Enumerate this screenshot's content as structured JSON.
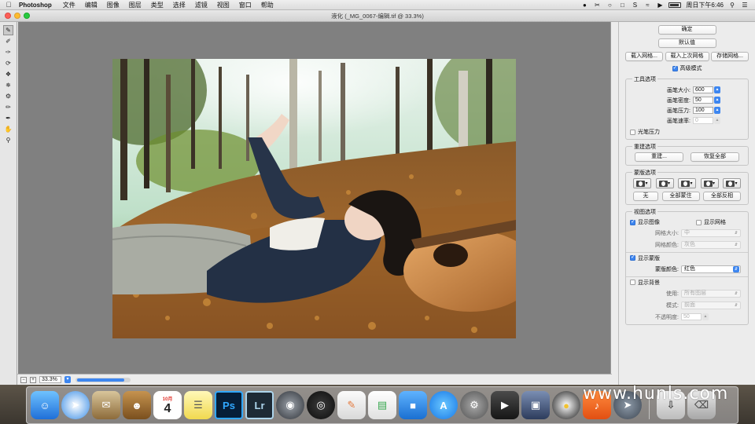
{
  "menubar": {
    "app_name": "Photoshop",
    "menus": [
      "文件",
      "编辑",
      "图像",
      "图层",
      "类型",
      "选择",
      "滤镜",
      "视图",
      "窗口",
      "帮助"
    ],
    "clock": "周日下午6:46"
  },
  "window": {
    "title": "液化 (_MG_0067-编辑.tif @ 33.3%)"
  },
  "status": {
    "zoom": "33.3%"
  },
  "panel": {
    "ok_label": "确定",
    "default_label": "默认值",
    "load_mesh": "载入网格...",
    "load_last_mesh": "载入上次网格",
    "save_mesh": "存储网格...",
    "advanced_mode": "高级模式",
    "tool_options": {
      "title": "工具选项",
      "brush_size_label": "画笔大小:",
      "brush_size": "600",
      "brush_density_label": "画笔密度:",
      "brush_density": "50",
      "brush_pressure_label": "画笔压力:",
      "brush_pressure": "100",
      "brush_rate_label": "画笔速率:",
      "brush_rate": "0",
      "stylus_pressure": "光笔压力"
    },
    "reconstruct": {
      "title": "重建选项",
      "reconstruct_label": "重建...",
      "restore_all_label": "恢复全部"
    },
    "mask": {
      "title": "蒙版选项",
      "none_label": "无",
      "mask_all_label": "全部蒙住",
      "invert_all_label": "全部反相"
    },
    "view": {
      "title": "视图选项",
      "show_image": "显示图像",
      "show_mesh": "显示网格",
      "mesh_size_label": "网格大小:",
      "mesh_size": "中",
      "mesh_color_label": "网格颜色:",
      "mesh_color": "灰色",
      "show_mask": "显示蒙版",
      "mask_color_label": "蒙版颜色:",
      "mask_color": "红色",
      "show_backdrop": "显示背景",
      "use_label": "使用:",
      "use": "所有图层",
      "mode_label": "模式:",
      "mode": "前面",
      "opacity_label": "不透明度:",
      "opacity": "50"
    }
  },
  "dock": {
    "calendar_month": "10月",
    "calendar_day": "4",
    "ps_label": "Ps",
    "lr_label": "Lr"
  },
  "watermark": "www.hunls.com"
}
